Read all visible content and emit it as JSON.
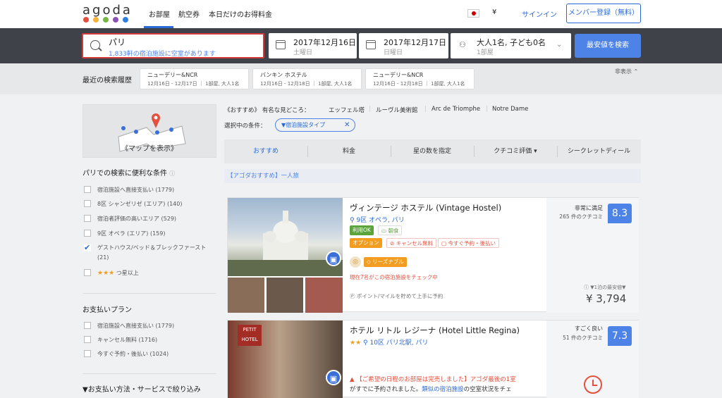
{
  "header": {
    "logo": "agoda",
    "nav": [
      "お部屋",
      "航空券",
      "本日だけのお得料金"
    ],
    "currency": "¥",
    "signin": "サインイン",
    "register": "メンバー登録（無料）",
    "logo_colors": [
      "#e4503d",
      "#f6b33c",
      "#74b843",
      "#8a52b5",
      "#2f7fe0"
    ]
  },
  "search": {
    "destination": "パリ",
    "availability": "1,833軒の宿泊施設に空室があります",
    "checkin_date": "2017年12月16日",
    "checkin_day": "土曜日",
    "checkout_date": "2017年12月17日",
    "checkout_day": "日曜日",
    "guests": "大人1名, 子ども0名",
    "rooms": "1部屋",
    "button": "最安値を検索"
  },
  "recent": {
    "title": "最近の検索履歴",
    "hide": "非表示",
    "items": [
      {
        "name": "ニューデリー&NCR",
        "detail": "12月16日 - 12月17日 ｜ 1部屋, 大人1名"
      },
      {
        "name": "バンキン ホステル",
        "detail": "12月16日 - 12月18日 ｜ 1部屋, 大人1名"
      },
      {
        "name": "ニューデリー&NCR",
        "detail": "12月16日 - 12月18日 ｜ 1部屋, 大人1名"
      }
    ]
  },
  "sidebar": {
    "map_label": "《マップを表示》",
    "filters_title": "パリでの検索に便利な条件",
    "filters": [
      {
        "label": "宿泊施設へ直接支払い (1779)",
        "checked": false
      },
      {
        "label": "8区 シャンゼリゼ (エリア) (140)",
        "checked": false
      },
      {
        "label": "宿泊者評価の高いエリア (529)",
        "checked": false
      },
      {
        "label": "9区 オペラ (エリア) (159)",
        "checked": false
      },
      {
        "label": "ゲストハウス/ベッド＆ブレックファースト (21)",
        "checked": true
      },
      {
        "label": "つ星以上",
        "checked": false,
        "stars": "★★★"
      }
    ],
    "payment_title": "お支払いプラン",
    "payment": [
      {
        "label": "宿泊施設へ直接支払い (1779)"
      },
      {
        "label": "キャンセル無料 (1716)"
      },
      {
        "label": "今すぐ予約・後払い (1024)"
      }
    ],
    "bottom_title": "▼お支払い方法・サービスで絞り込み"
  },
  "main": {
    "sights_label": "《おすすめ》 有名な見どころ：",
    "sights": [
      "エッフェル塔",
      "ルーヴル美術館",
      "Arc de Triomphe",
      "Notre Dame"
    ],
    "selected_label": "選択中の条件：",
    "selected_chip": "▼宿泊施設タイプ",
    "sort": [
      "おすすめ",
      "料金",
      "星の数を指定",
      "クチコミ評価 ▾",
      "シークレットディール"
    ],
    "promo": "【アゴダおすすめ】一人旅"
  },
  "hotels": [
    {
      "name": "ヴィンテージ ホステル (Vintage Hostel)",
      "location": "9区 オペラ, パリ",
      "tags": [
        "利用OK",
        "朝食"
      ],
      "option": "オプション",
      "free_cancel": "キャンセル無料",
      "pay_later": "今すぐ予約・後払い",
      "reasonable": "リーズナブル",
      "viewing": "現在7名がこの宿泊施設をチェック中",
      "points": "ポイント/マイルを貯めて上手に予約",
      "rating_text": "非常に満足",
      "reviews": "265 件のクチコミ",
      "score": "8.3",
      "price_note": "▼1泊の最安値▼",
      "price": "¥ 3,794"
    },
    {
      "name": "ホテル リトル レジーナ (Hotel Little Regina)",
      "stars": "★★",
      "location": "10区 パリ北駅, パリ",
      "soldout_a": "【ご希望の日程のお部屋は完売しました】アゴダ最後の1室",
      "soldout_b": "がすでに予約されました。",
      "soldout_link": "類似の宿泊施設",
      "soldout_c": "の空室状況をチェ",
      "rating_text": "すごく良い",
      "reviews": "51 件のクチコミ",
      "score": "7.3"
    }
  ]
}
